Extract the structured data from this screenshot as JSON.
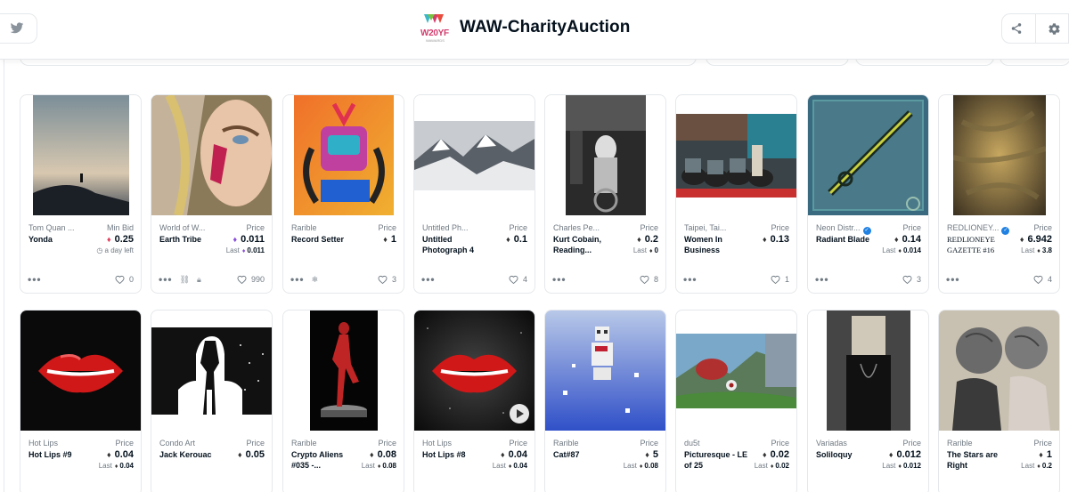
{
  "header": {
    "title": "WAW-CharityAuction",
    "logo_text": "W20YF",
    "logo_subtext": "WAWARDS",
    "left_icon": "twitter-icon",
    "right_icons": [
      "share-icon",
      "gear-icon"
    ]
  },
  "colors": {
    "accent_blue": "#2081e2",
    "text_primary": "#04111d",
    "text_secondary": "#707a83",
    "border": "#e5e8eb"
  },
  "cards_row1": [
    {
      "collection": "Tom Quan ...",
      "title": "Yonda",
      "price_label": "Min Bid",
      "price": "0.25",
      "time_left": "a day left",
      "likes": "0",
      "extra_icons": []
    },
    {
      "collection": "World of W...",
      "title": "Earth Tribe",
      "price_label": "Price",
      "price": "0.011",
      "last_label": "Last",
      "last": "0.011",
      "likes": "990",
      "extra_icons": [
        "link-icon",
        "lock-icon"
      ]
    },
    {
      "collection": "Rarible",
      "title": "Record Setter",
      "price_label": "Price",
      "price": "1",
      "likes": "3",
      "extra_icons": [
        "snowflake-icon"
      ]
    },
    {
      "collection": "Untitled Ph...",
      "title": "Untitled Photograph 4",
      "price_label": "Price",
      "price": "0.1",
      "likes": "4",
      "extra_icons": []
    },
    {
      "collection": "Charles Pe...",
      "title": "Kurt Cobain, Reading...",
      "price_label": "Price",
      "price": "0.2",
      "last_label": "Last",
      "last": "0",
      "likes": "8",
      "extra_icons": []
    },
    {
      "collection": "Taipei, Tai...",
      "title": "Women In Business",
      "price_label": "Price",
      "price": "0.13",
      "likes": "1",
      "extra_icons": []
    },
    {
      "collection": "Neon Distr...",
      "verified": true,
      "title": "Radiant Blade",
      "price_label": "Price",
      "price": "0.14",
      "last_label": "Last",
      "last": "0.014",
      "likes": "3",
      "extra_icons": []
    },
    {
      "collection": "REDLIONEY...",
      "verified": true,
      "title": "REDLIONEYE GAZETTE #16",
      "price_label": "Price",
      "price": "6.942",
      "last_label": "Last",
      "last": "3.8",
      "likes": "4",
      "extra_icons": []
    }
  ],
  "cards_row2": [
    {
      "collection": "Hot Lips",
      "title": "Hot Lips #9",
      "price_label": "Price",
      "price": "0.04",
      "last_label": "Last",
      "last": "0.04"
    },
    {
      "collection": "Condo Art",
      "title": "Jack Kerouac",
      "price_label": "Price",
      "price": "0.05"
    },
    {
      "collection": "Rarible",
      "title": "Crypto Aliens #035 -...",
      "price_label": "Price",
      "price": "0.08",
      "last_label": "Last",
      "last": "0.08"
    },
    {
      "collection": "Hot Lips",
      "title": "Hot Lips #8",
      "price_label": "Price",
      "price": "0.04",
      "last_label": "Last",
      "last": "0.04"
    },
    {
      "collection": "Rarible",
      "title": "Cat#87",
      "price_label": "Price",
      "price": "5",
      "last_label": "Last",
      "last": "0.08"
    },
    {
      "collection": "du5t",
      "title": "Picturesque - LE of 25",
      "price_label": "Price",
      "price": "0.02",
      "last_label": "Last",
      "last": "0.02"
    },
    {
      "collection": "Variadas",
      "title": "Soliloquy",
      "price_label": "Price",
      "price": "0.012",
      "last_label": "Last",
      "last": "0.012"
    },
    {
      "collection": "Rarible",
      "title": "The Stars are Right",
      "price_label": "Price",
      "price": "1",
      "last_label": "Last",
      "last": "0.2"
    }
  ]
}
